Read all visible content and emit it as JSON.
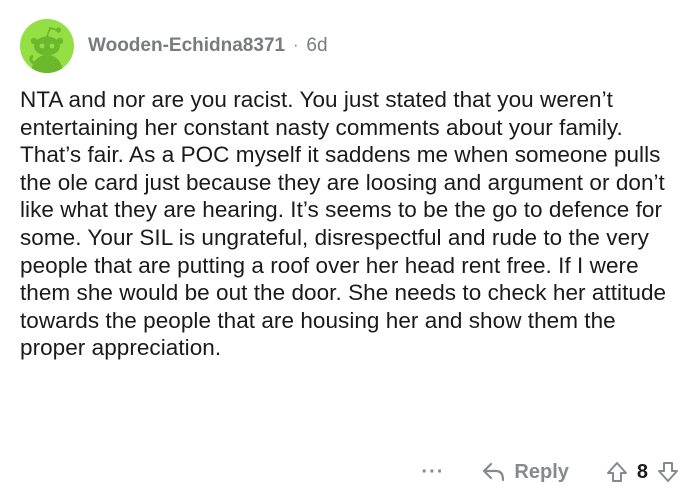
{
  "comment": {
    "username": "Wooden-Echidna8371",
    "separator": "·",
    "age": "6d",
    "body": "NTA and nor are you racist. You just stated that you weren’t entertaining her constant nasty comments about your family. That’s fair. As a POC myself it saddens me when someone pulls the ole card just because they are loosing and argument or don’t like what they are hearing. It’s seems to be the go to defence for some. Your SIL is ungrateful, disrespectful and rude to the very people that are putting a roof over her head rent free. If I were them she would be out the door. She needs to check her attitude towards the people that are housing her and show them the proper appreciation."
  },
  "actions": {
    "more_label": "···",
    "reply_label": "Reply",
    "score": "8"
  },
  "icons": {
    "avatar": "reddit-snoo-avatar",
    "reply": "reply-arrow-icon",
    "upvote": "upvote-arrow-icon",
    "downvote": "downvote-arrow-icon"
  },
  "colors": {
    "avatar_bg": "#94e044",
    "meta_text": "#787c7e",
    "body_text": "#1a1a1b",
    "action_text": "#878a8c"
  }
}
